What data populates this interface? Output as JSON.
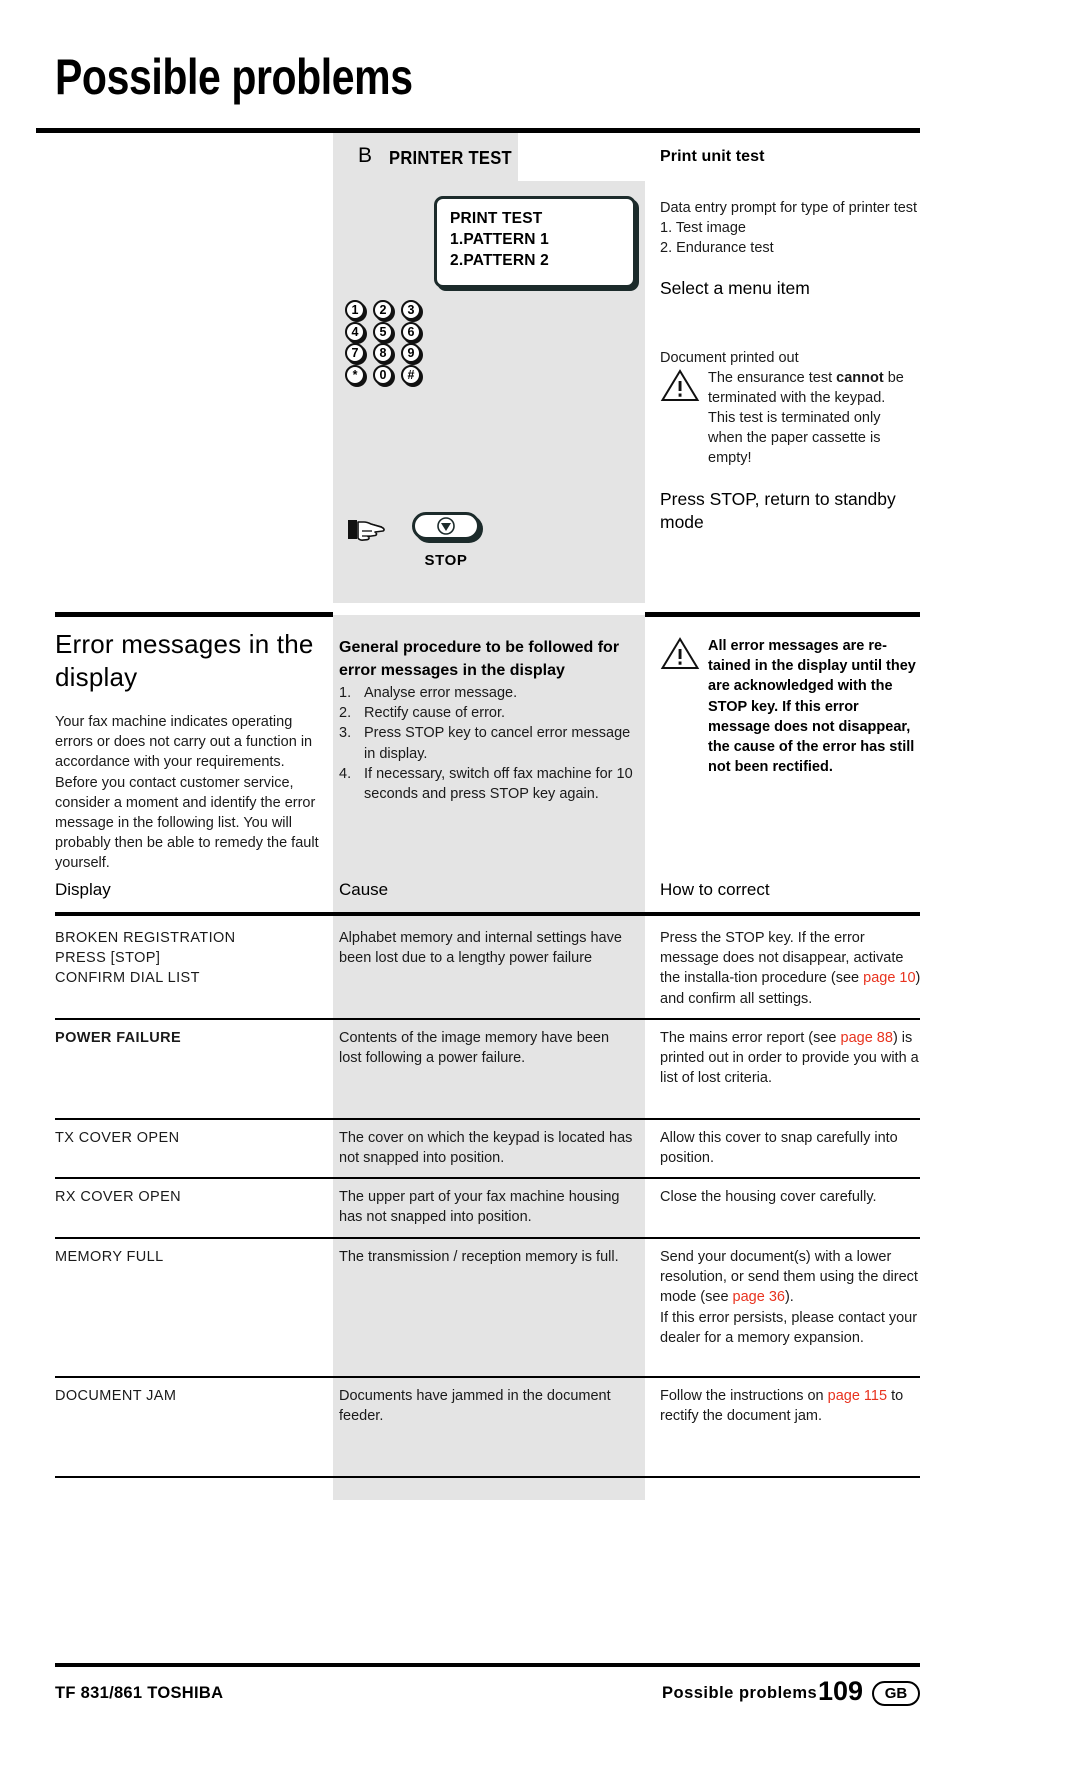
{
  "page_title": "Possible problems",
  "printer_test": {
    "section_letter": "B",
    "section_name": "PRINTER TEST",
    "lcd": {
      "line1": "PRINT TEST",
      "line2": "1.PATTERN 1",
      "line3": "2.PATTERN 2"
    },
    "keypad": [
      "1",
      "2",
      "3",
      "4",
      "5",
      "6",
      "7",
      "8",
      "9",
      "*",
      "0",
      "#"
    ],
    "stop_label": "STOP",
    "heading": "Print unit test",
    "prompt_line": "Data entry prompt for type of printer test",
    "option1": "1. Test image",
    "option2": "2. Endurance test",
    "select_heading": "Select a menu item",
    "document_printed": "Document printed out",
    "warning_pre": "The ensurance test ",
    "warning_bold": "cannot",
    "warning_post": " be terminated with the keypad. This test is terminated only when the paper cassette is empty!",
    "press_stop_heading": "Press STOP, return to standby mode"
  },
  "error_section": {
    "heading": "Error messages in the display",
    "intro": "Your fax machine indicates operating errors or does not carry out a function in accordance with your requirements. Before you contact customer service, consider a moment and identify the error message in the following list. You will probably then be able to remedy the fault yourself.",
    "procedure_heading": "General procedure to be followed for error messages in the display",
    "procedure_steps": [
      {
        "num": "1.",
        "text": "Analyse error message."
      },
      {
        "num": "2.",
        "text": "Rectify cause of error."
      },
      {
        "num": "3.",
        "text": "Press STOP key to cancel error message in display."
      },
      {
        "num": "4.",
        "text": "If necessary, switch off fax machine for 10 seconds and press STOP key again."
      }
    ],
    "retained_warning": "All error messages are re-tained in the display until they are acknowledged with the STOP key. If this error message does not disappear, the cause of the error has still not been rectified."
  },
  "table": {
    "headers": {
      "display": "Display",
      "cause": "Cause",
      "correct": "How to correct"
    },
    "rows": [
      {
        "display": "BROKEN  REGISTRATION\nPRESS  [STOP]\nCONFIRM DIAL LIST",
        "display_bold": false,
        "cause": "Alphabet memory and internal settings have been lost due to a lengthy power failure",
        "correct_parts": [
          {
            "text": "Press the STOP key. If the error message does not disappear, activate the installa-tion procedure (see ",
            "red": false
          },
          {
            "text": "page 10",
            "red": true
          },
          {
            "text": ") and confirm all settings.",
            "red": false
          }
        ]
      },
      {
        "display": "POWER  FAILURE",
        "display_bold": true,
        "cause": "Contents of the image memory have been lost following a power failure.",
        "correct_parts": [
          {
            "text": "The mains error report (see ",
            "red": false
          },
          {
            "text": "page 88",
            "red": true
          },
          {
            "text": ") is printed out in order to provide you with a list of lost criteria.",
            "red": false
          }
        ]
      },
      {
        "display": "TX COVER OPEN",
        "display_bold": false,
        "cause": "The cover on which the keypad is located has not snapped into position.",
        "correct_parts": [
          {
            "text": "Allow this cover to snap carefully into position.",
            "red": false
          }
        ]
      },
      {
        "display": "RX COVER OPEN",
        "display_bold": false,
        "cause": "The upper part of your fax machine housing has not snapped into position.",
        "correct_parts": [
          {
            "text": "Close the housing cover carefully.",
            "red": false
          }
        ]
      },
      {
        "display": "MEMORY FULL",
        "display_bold": false,
        "cause": "The transmission / reception memory is full.",
        "correct_parts": [
          {
            "text": "Send your document(s) with a lower resolution, or send them using the direct mode (see ",
            "red": false
          },
          {
            "text": "page 36",
            "red": true
          },
          {
            "text": ").\nIf this error persists, please contact your dealer for a memory expansion.",
            "red": false
          }
        ]
      },
      {
        "display": "DOCUMENT JAM",
        "display_bold": false,
        "cause": "Documents have jammed in the document feeder.",
        "correct_parts": [
          {
            "text": "Follow the instructions on ",
            "red": false
          },
          {
            "text": "page 115",
            "red": true
          },
          {
            "text": " to rectify the document jam.",
            "red": false
          }
        ]
      }
    ]
  },
  "footer": {
    "left": "TF 831/861 TOSHIBA",
    "middle": "Possible  problems",
    "page_number": "109",
    "locale": "GB"
  },
  "colors": {
    "link_red": "#e8321e",
    "shade_gray": "#e4e4e4",
    "rule_black": "#000000"
  }
}
